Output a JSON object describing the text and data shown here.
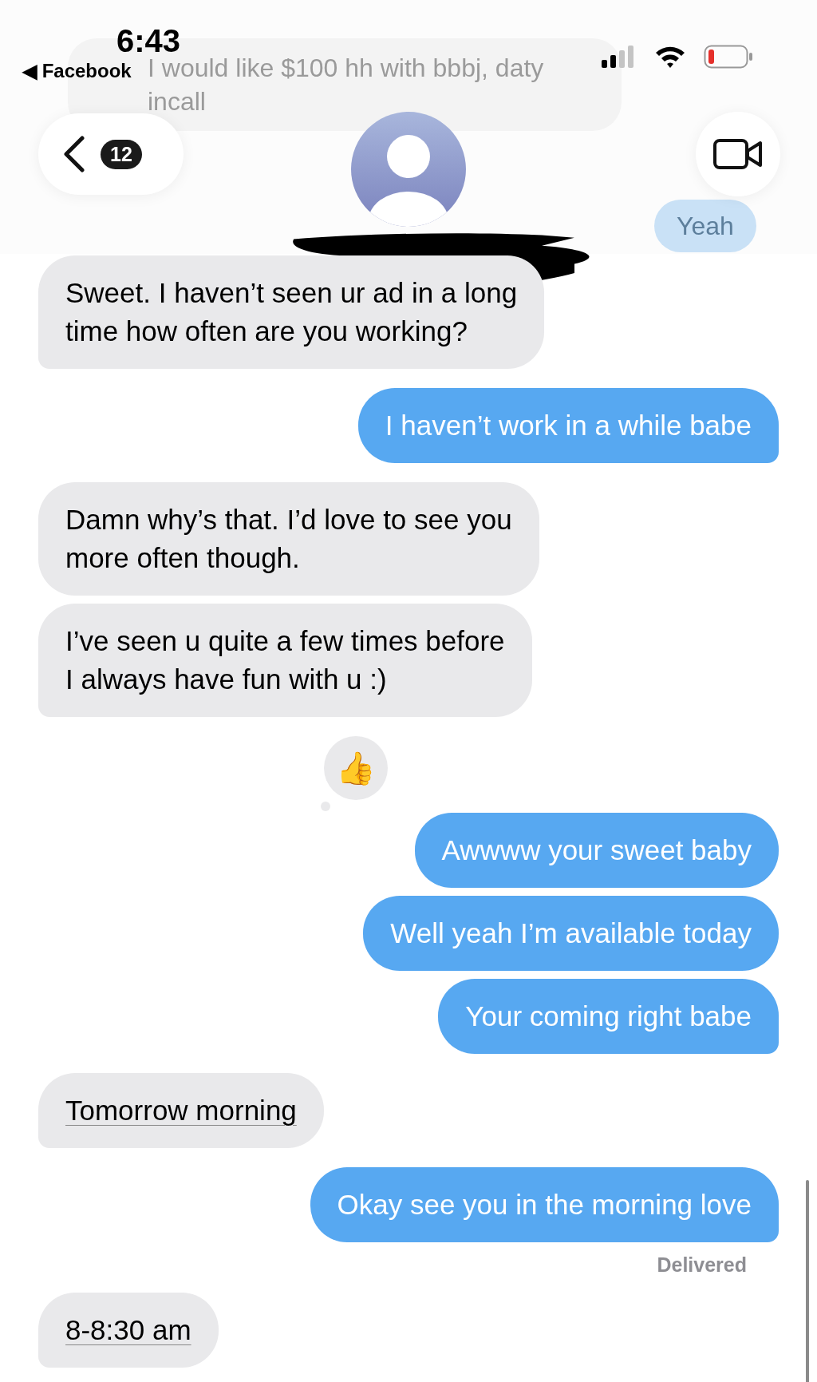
{
  "status_bar": {
    "time": "6:43",
    "back_app": "◀ Facebook"
  },
  "background_messages": [
    {
      "kind": "incoming",
      "text": "I would like $100 hh with bbbj, daty\nincall"
    },
    {
      "kind": "outgoing",
      "text": "Yeah"
    }
  ],
  "nav": {
    "back_badge": "12"
  },
  "messages": [
    {
      "kind": "incoming",
      "text": "Sweet. I haven’t seen ur ad in a long\ntime how often are you working?",
      "tail": true,
      "underlined": false
    },
    {
      "kind": "outgoing",
      "text": "I haven’t work in a while babe",
      "tail": true,
      "underlined": false
    },
    {
      "kind": "incoming",
      "text": "Damn why’s that. I’d love to see you\nmore often though.",
      "tail": false,
      "underlined": false
    },
    {
      "kind": "incoming",
      "text": "I’ve seen u quite a few times before\nI always have fun with u :)",
      "tail": true,
      "underlined": false
    },
    {
      "kind": "outgoing",
      "text": "Awwww your sweet baby",
      "tail": false,
      "underlined": false,
      "reaction": "👍"
    },
    {
      "kind": "outgoing",
      "text": "Well yeah I’m available today",
      "tail": false,
      "underlined": false
    },
    {
      "kind": "outgoing",
      "text": "Your coming right babe",
      "tail": true,
      "underlined": false
    },
    {
      "kind": "incoming",
      "text": "Tomorrow morning",
      "tail": true,
      "underlined": true
    },
    {
      "kind": "outgoing",
      "text": "Okay see you in the morning love",
      "tail": true,
      "underlined": false,
      "status": "Delivered"
    },
    {
      "kind": "incoming",
      "text": "8-8:30 am",
      "tail": true,
      "underlined": true
    }
  ]
}
